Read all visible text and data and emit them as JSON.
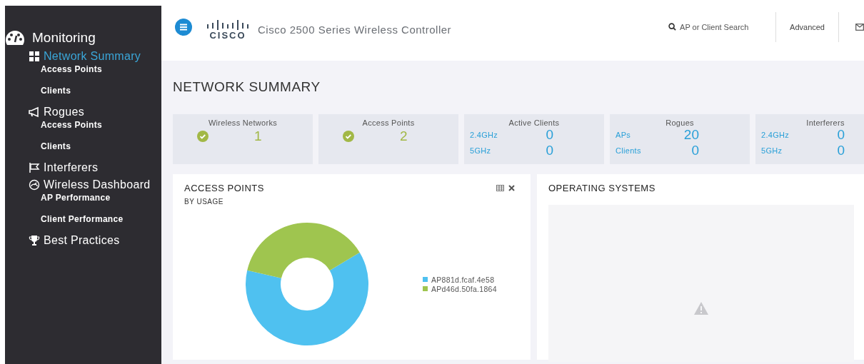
{
  "sidebar": {
    "title": "Monitoring",
    "sections": [
      {
        "label": "Network Summary",
        "selected": true,
        "children": [
          {
            "label": "Access Points"
          },
          {
            "label": "Clients"
          }
        ]
      },
      {
        "label": "Rogues",
        "selected": false,
        "children": [
          {
            "label": "Access Points"
          },
          {
            "label": "Clients"
          }
        ]
      },
      {
        "label": "Interferers",
        "selected": false
      },
      {
        "label": "Wireless Dashboard",
        "selected": false,
        "children": [
          {
            "label": "AP Performance"
          },
          {
            "label": "Client Performance"
          }
        ]
      },
      {
        "label": "Best Practices",
        "selected": false
      }
    ]
  },
  "header": {
    "logo": "CISCO",
    "title": "Cisco 2500 Series Wireless Controller",
    "search": {
      "placeholder": "AP or Client Search"
    },
    "advanced": "Advanced"
  },
  "page_title": "NETWORK SUMMARY",
  "tiles": [
    {
      "kind": "check",
      "title": "Wireless Networks",
      "value": "1"
    },
    {
      "kind": "check",
      "title": "Access Points",
      "value": "2"
    },
    {
      "kind": "split",
      "title": "Active Clients",
      "rows": [
        {
          "label": "2.4GHz",
          "value": "0"
        },
        {
          "label": "5GHz",
          "value": "0"
        }
      ]
    },
    {
      "kind": "split",
      "title": "Rogues",
      "rows": [
        {
          "label": "APs",
          "value": "20"
        },
        {
          "label": "Clients",
          "value": "0"
        }
      ]
    },
    {
      "kind": "split",
      "title": "Interferers",
      "rows": [
        {
          "label": "2.4GHz",
          "value": "0"
        },
        {
          "label": "5GHz",
          "value": "0"
        }
      ]
    }
  ],
  "access_points_card": {
    "title": "ACCESS POINTS",
    "subtitle": "BY USAGE",
    "legend": [
      {
        "label": "AP881d.fcaf.4e58",
        "color": "#4fc1f0"
      },
      {
        "label": "APd46d.50fa.1864",
        "color": "#9fc54f"
      }
    ]
  },
  "os_card": {
    "title": "OPERATING SYSTEMS"
  }
}
